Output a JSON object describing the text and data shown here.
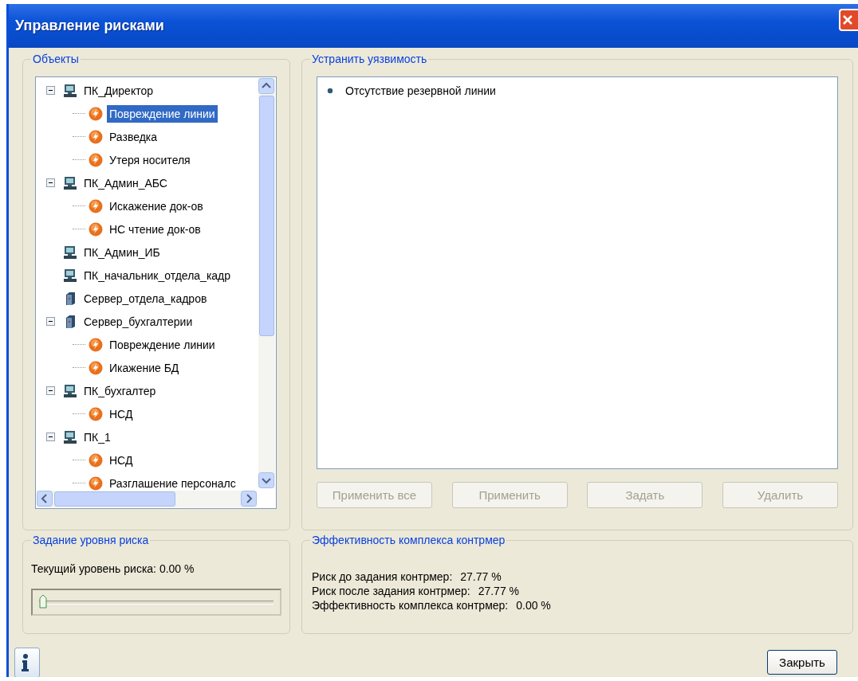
{
  "window": {
    "title": "Управление рисками"
  },
  "objects": {
    "title": "Объекты",
    "tree": [
      {
        "kind": "pc",
        "label": "ПК_Директор",
        "expanded": true,
        "children": [
          {
            "kind": "threat",
            "label": "Повреждение линии",
            "selected": true
          },
          {
            "kind": "threat",
            "label": "Разведка",
            "selected": false
          },
          {
            "kind": "threat",
            "label": "Утеря носителя",
            "selected": false
          }
        ]
      },
      {
        "kind": "pc",
        "label": "ПК_Админ_АБС",
        "expanded": true,
        "children": [
          {
            "kind": "threat",
            "label": "Искажение док-ов",
            "selected": false
          },
          {
            "kind": "threat",
            "label": "НС чтение док-ов",
            "selected": false
          }
        ]
      },
      {
        "kind": "pc",
        "label": "ПК_Админ_ИБ"
      },
      {
        "kind": "pc",
        "label": "ПК_начальник_отдела_кадр"
      },
      {
        "kind": "server",
        "label": "Сервер_отдела_кадров"
      },
      {
        "kind": "server",
        "label": "Сервер_бухгалтерии",
        "expanded": true,
        "children": [
          {
            "kind": "threat",
            "label": "Повреждение линии",
            "selected": false
          },
          {
            "kind": "threat",
            "label": "Икажение БД",
            "selected": false
          }
        ]
      },
      {
        "kind": "pc",
        "label": "ПК_бухгалтер",
        "expanded": true,
        "children": [
          {
            "kind": "threat",
            "label": "НСД",
            "selected": false
          }
        ]
      },
      {
        "kind": "pc",
        "label": "ПК_1",
        "expanded": true,
        "children": [
          {
            "kind": "threat",
            "label": "НСД",
            "selected": false
          },
          {
            "kind": "threat",
            "label": "Разглашение персоналс",
            "selected": false
          }
        ]
      }
    ]
  },
  "fix": {
    "title": "Устранить уязвимость",
    "items": [
      "Отсутствие резервной линии"
    ],
    "buttons": [
      {
        "label": "Применить все",
        "disabled": true
      },
      {
        "label": "Применить",
        "disabled": true
      },
      {
        "label": "Задать",
        "disabled": true
      },
      {
        "label": "Удалить",
        "disabled": true
      }
    ]
  },
  "risk_level": {
    "title": "Задание уровня риска",
    "reading": "Текущий уровень риска: 0.00 %",
    "level": 0
  },
  "effectiveness": {
    "title": "Эффективность комплекса контрмер",
    "lines": [
      {
        "label": "Риск до задания контрмер:",
        "value": "27.77 %"
      },
      {
        "label": "Риск после задания контрмер:",
        "value": "27.77 %"
      },
      {
        "label": "Эффективность комплекса контрмер:",
        "value": "0.00 %"
      }
    ]
  },
  "footer": {
    "close_button": "Закрыть"
  }
}
